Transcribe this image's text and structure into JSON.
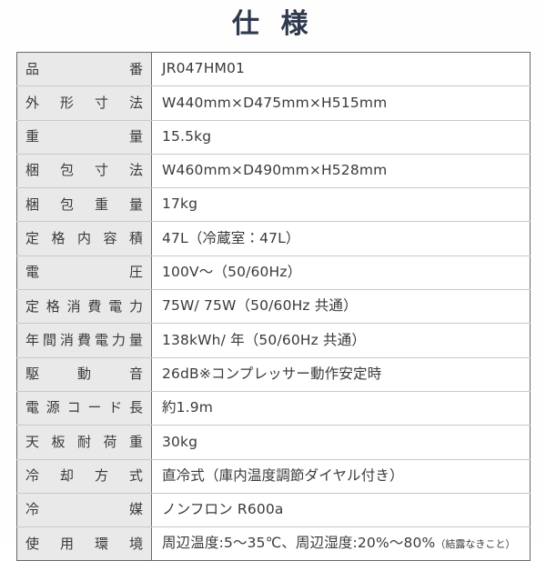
{
  "title": "仕 様",
  "accent_color": "#303a4e",
  "label_bg_color": "#e9e9e9",
  "border_color": "#6a6a6a",
  "text_color": "#3a3a3a",
  "rows": [
    {
      "label": "品番",
      "value": "JR047HM01",
      "note": ""
    },
    {
      "label": "外形寸法",
      "value": "W440mm×D475mm×H515mm",
      "note": ""
    },
    {
      "label": "重量",
      "value": "15.5kg",
      "note": ""
    },
    {
      "label": "梱包寸法",
      "value": "W460mm×D490mm×H528mm",
      "note": ""
    },
    {
      "label": "梱包重量",
      "value": "17kg",
      "note": ""
    },
    {
      "label": "定格内容積",
      "value": "47L（冷蔵室：47L）",
      "note": ""
    },
    {
      "label": "電圧",
      "value": "100V〜（50/60Hz）",
      "note": ""
    },
    {
      "label": "定格消費電力",
      "value": "75W/ 75W（50/60Hz 共通）",
      "note": ""
    },
    {
      "label": "年間消費電力量",
      "value": "138kWh/ 年（50/60Hz 共通）",
      "note": ""
    },
    {
      "label": "駆動音",
      "value": "26dB※コンプレッサー動作安定時",
      "note": ""
    },
    {
      "label": "電源コード長",
      "value": "約1.9m",
      "note": ""
    },
    {
      "label": "天板耐荷重",
      "value": "30kg",
      "note": ""
    },
    {
      "label": "冷却方式",
      "value": "直冷式（庫内温度調節ダイヤル付き）",
      "note": ""
    },
    {
      "label": "冷媒",
      "value": "ノンフロン R600a",
      "note": ""
    },
    {
      "label": "使用環境",
      "value": "周辺温度:5〜35℃、周辺湿度:20%〜80%",
      "note": "（結露なきこと）"
    }
  ]
}
